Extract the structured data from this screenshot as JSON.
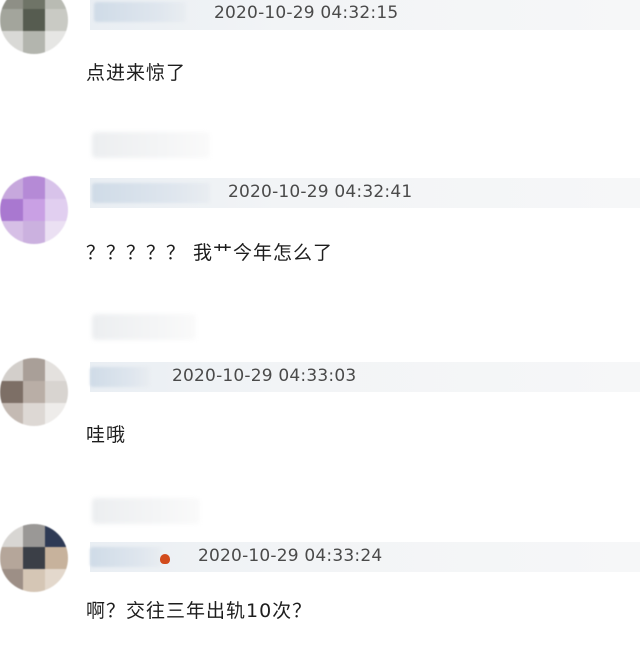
{
  "comments": [
    {
      "timestamp": "2020-10-29 04:32:15",
      "text": "点进来惊了"
    },
    {
      "timestamp": "2020-10-29 04:32:41",
      "text": "？？？？？ 我艹今年怎么了"
    },
    {
      "timestamp": "2020-10-29 04:33:03",
      "text": "哇哦"
    },
    {
      "timestamp": "2020-10-29 04:33:24",
      "text": "啊？交往三年出轨10次？"
    }
  ],
  "colors": {
    "text": "#1d1d1d",
    "timestamp": "#4a4a4a",
    "meta_bar": "#eef1f4",
    "badge": "#d24b1c"
  }
}
